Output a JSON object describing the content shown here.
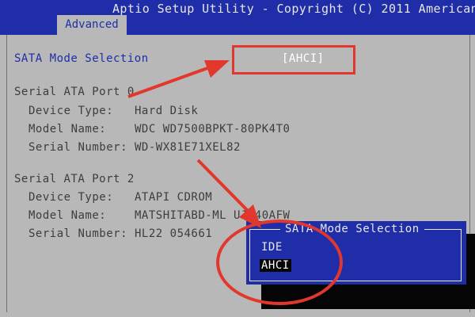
{
  "header": {
    "title": "Aptio Setup Utility - Copyright (C) 2011 American",
    "active_tab": "Advanced"
  },
  "sata_mode": {
    "label": "SATA Mode Selection",
    "value": "[AHCI]"
  },
  "ports": [
    {
      "title": "Serial ATA Port 0",
      "device_type_label": "Device Type:",
      "device_type": "Hard Disk",
      "model_label": "Model Name:",
      "model": "WDC WD7500BPKT-80PK4T0",
      "serial_label": "Serial Number:",
      "serial": "WD-WX81E71XEL82"
    },
    {
      "title": "Serial ATA Port 2",
      "device_type_label": "Device Type:",
      "device_type": "ATAPI CDROM",
      "model_label": "Model Name:",
      "model": "MATSHITABD-ML UJ240AFW",
      "serial_label": "Serial Number:",
      "serial": "HL22  054661"
    }
  ],
  "popup": {
    "title": "SATA Mode Selection",
    "options": [
      "IDE",
      "AHCI"
    ],
    "selected": "AHCI"
  },
  "colors": {
    "bios_blue": "#1f2ea8",
    "bios_gray": "#b8b8b8",
    "annotation_red": "#e2372c"
  }
}
